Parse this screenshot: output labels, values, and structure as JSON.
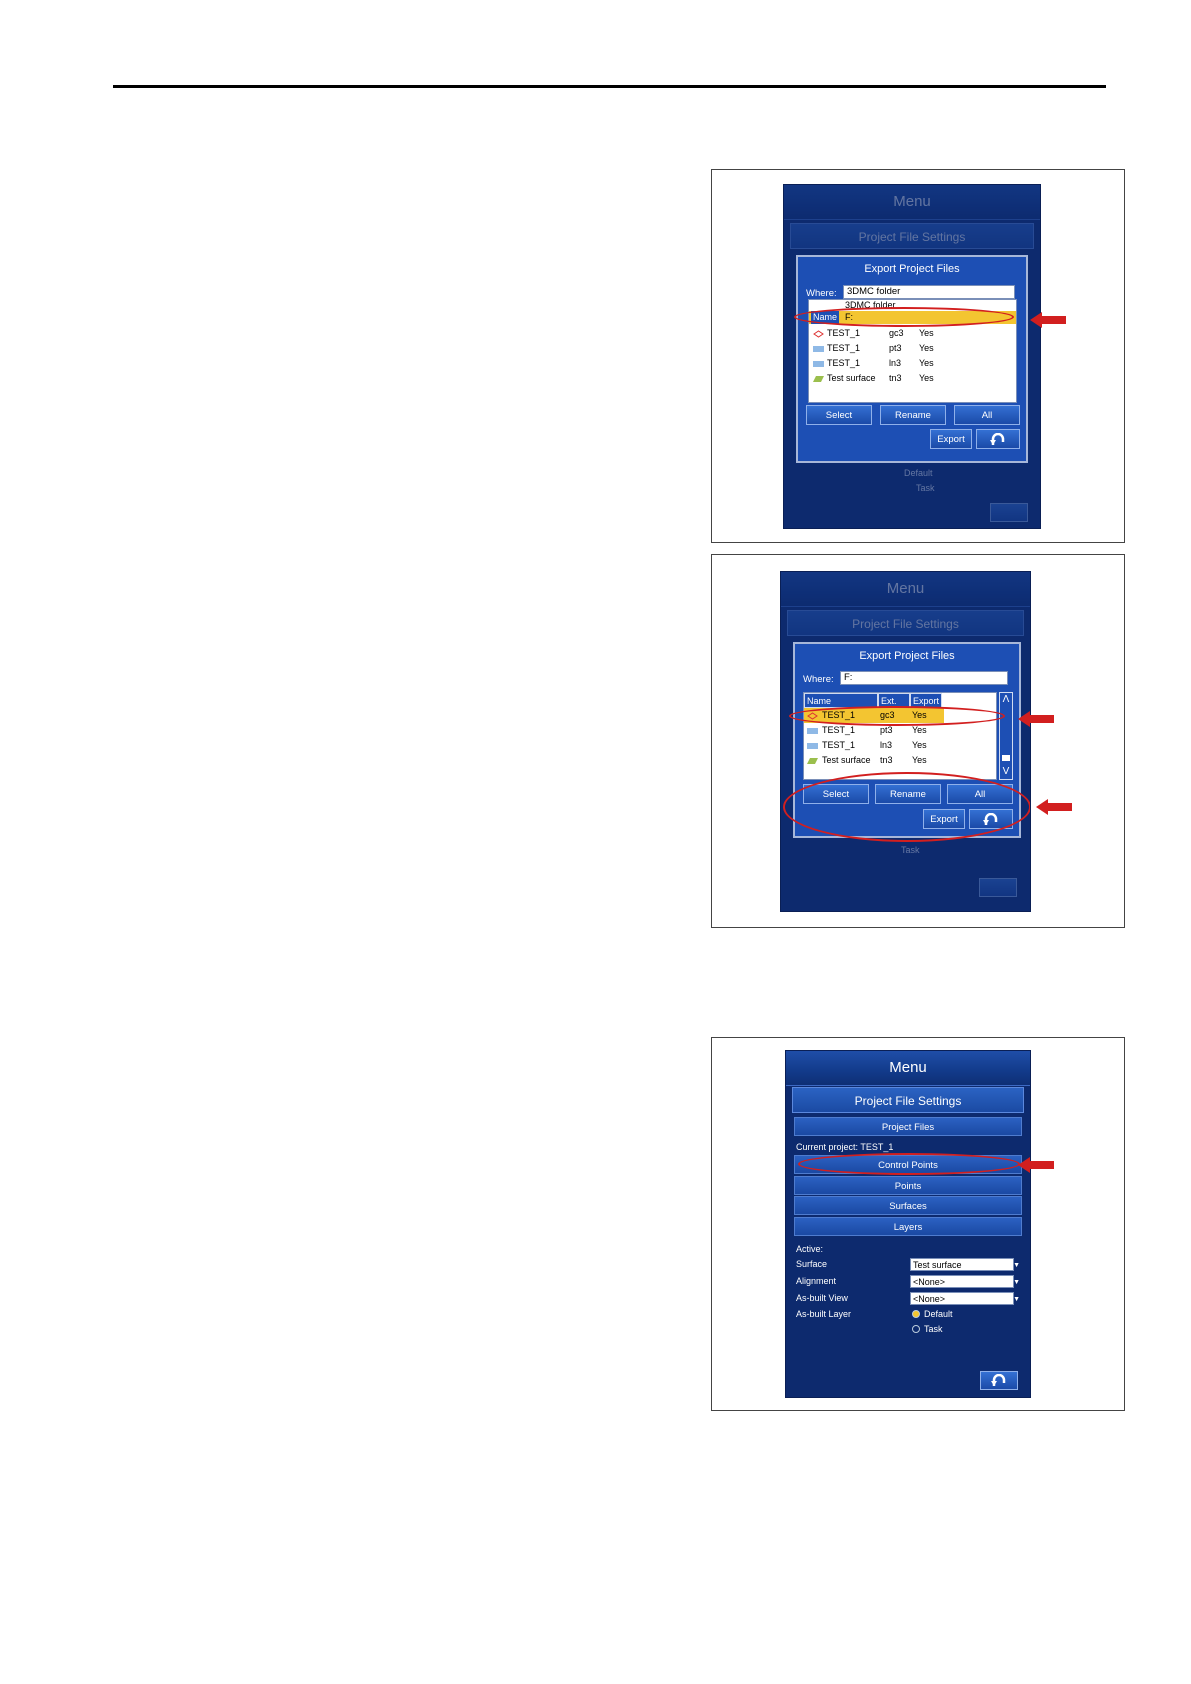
{
  "fig1": {
    "menu_title": "Menu",
    "sub_title": "Project File Settings",
    "dialog_title": "Export Project Files",
    "where_label": "Where:",
    "where_value": "3DMC folder",
    "dropdown_opt1": "3DMC folder",
    "dropdown_opt2": "F:",
    "col_name_partial": "Name",
    "rows": [
      {
        "name": "TEST_1",
        "ext": "gc3",
        "export": "Yes"
      },
      {
        "name": "TEST_1",
        "ext": "pt3",
        "export": "Yes"
      },
      {
        "name": "TEST_1",
        "ext": "ln3",
        "export": "Yes"
      },
      {
        "name": "Test surface",
        "ext": "tn3",
        "export": "Yes"
      }
    ],
    "btn_select": "Select",
    "btn_rename": "Rename",
    "btn_all": "All",
    "btn_export": "Export",
    "bg_default": "Default",
    "bg_task": "Task"
  },
  "fig2": {
    "menu_title": "Menu",
    "sub_title": "Project File Settings",
    "dialog_title": "Export Project Files",
    "where_label": "Where:",
    "where_value": "F:",
    "col_name": "Name",
    "col_ext": "Ext.",
    "col_export": "Export",
    "rows": [
      {
        "name": "TEST_1",
        "ext": "gc3",
        "export": "Yes"
      },
      {
        "name": "TEST_1",
        "ext": "pt3",
        "export": "Yes"
      },
      {
        "name": "TEST_1",
        "ext": "ln3",
        "export": "Yes"
      },
      {
        "name": "Test surface",
        "ext": "tn3",
        "export": "Yes"
      }
    ],
    "btn_select": "Select",
    "btn_rename": "Rename",
    "btn_all": "All",
    "btn_export": "Export",
    "bg_task": "Task"
  },
  "fig3": {
    "menu_title": "Menu",
    "sub_title": "Project File Settings",
    "project_files": "Project Files",
    "current_project": "Current project: TEST_1",
    "control_points": "Control Points",
    "points": "Points",
    "surfaces": "Surfaces",
    "layers": "Layers",
    "active_label": "Active:",
    "surface_label": "Surface",
    "surface_value": "Test surface",
    "alignment_label": "Alignment",
    "alignment_value": "<None>",
    "asbuilt_view_label": "As-built View",
    "asbuilt_view_value": "<None>",
    "asbuilt_layer_label": "As-built Layer",
    "radio_default": "Default",
    "radio_task": "Task"
  },
  "colors": {
    "screen_bg": "#0d2a6e",
    "dialog_bg": "#1d4fb4",
    "highlight": "#f3c531",
    "annotation_red": "#d21f1f"
  }
}
